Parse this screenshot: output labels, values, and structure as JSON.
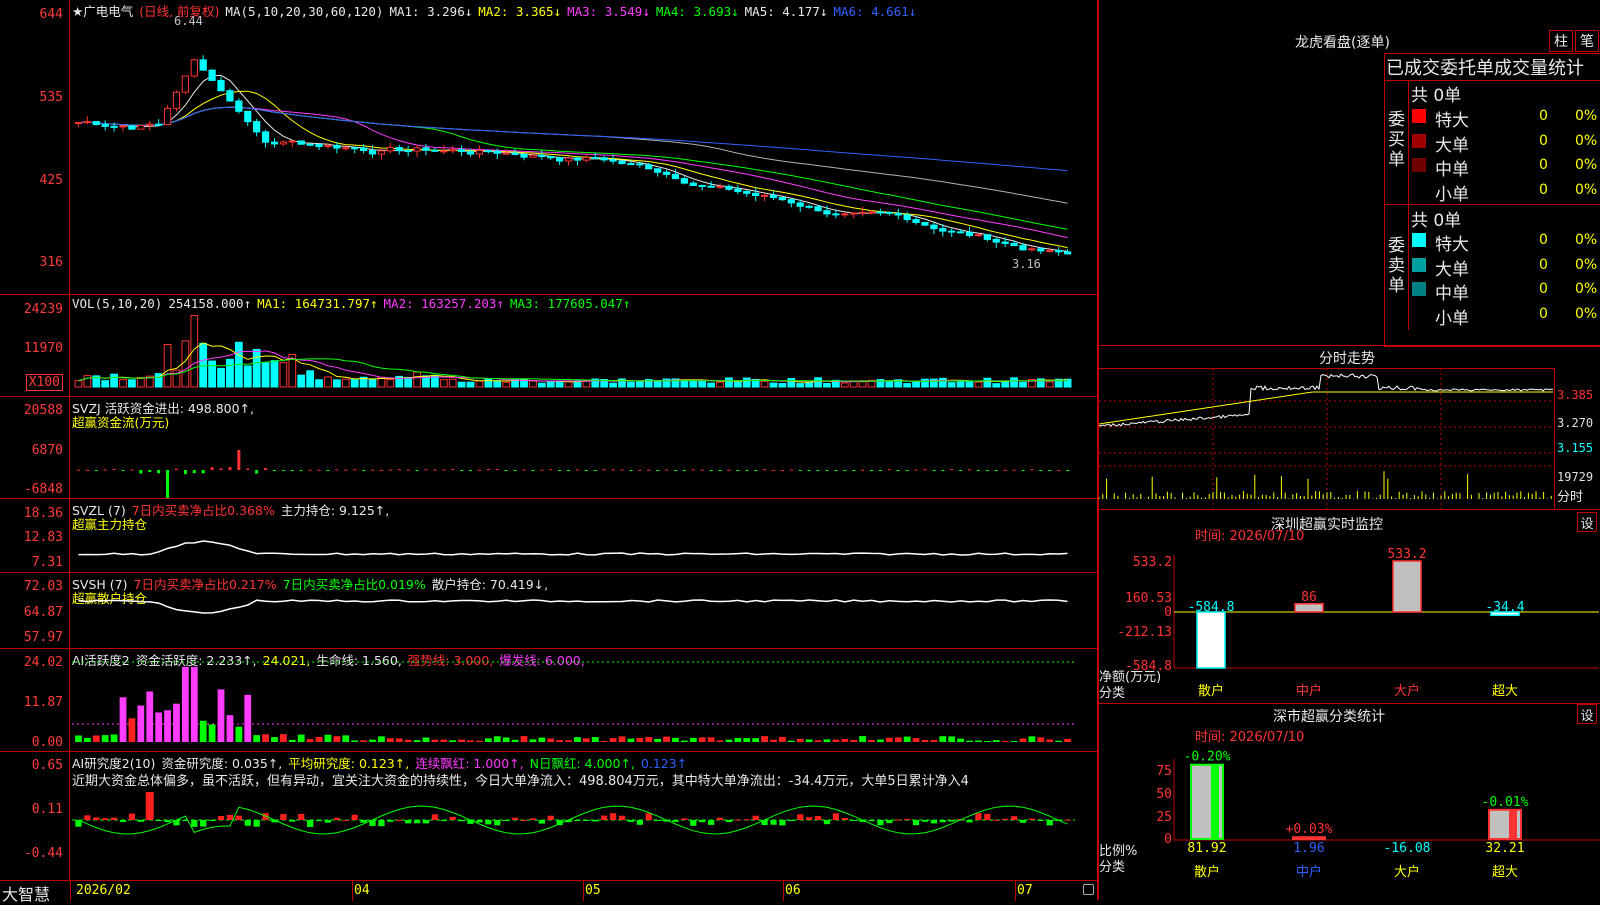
{
  "stock": {
    "name": "★广电电气",
    "period": "(日线, 前复权)",
    "high_label": "6.44",
    "low_label": "3.16"
  },
  "price_panel": {
    "ticks": [
      "644",
      "535",
      "425",
      "316"
    ],
    "ma": [
      {
        "label": "MA(5,10,20,30,60,120)",
        "color": "#e8e8e8"
      },
      {
        "label": "MA1: 3.296↓",
        "color": "#e8e8e8"
      },
      {
        "label": "MA2: 3.365↓",
        "color": "#ffff00"
      },
      {
        "label": "MA3: 3.549↓",
        "color": "#ff3cff"
      },
      {
        "label": "MA4: 3.693↓",
        "color": "#00ff00"
      },
      {
        "label": "MA5: 4.177↓",
        "color": "#e8e8e8"
      },
      {
        "label": "MA6: 4.661↓",
        "color": "#3060ff"
      }
    ]
  },
  "vol_panel": {
    "ticks": [
      "24239",
      "11970",
      "X100"
    ],
    "labels": [
      {
        "label": "VOL(5,10,20)",
        "color": "#e8e8e8"
      },
      {
        "label": "254158.000↑",
        "color": "#e8e8e8"
      },
      {
        "label": "MA1: 164731.797↑",
        "color": "#ffff00"
      },
      {
        "label": "MA2: 163257.203↑",
        "color": "#ff3cff"
      },
      {
        "label": "MA3: 177605.047↑",
        "color": "#00ff00"
      }
    ]
  },
  "svzj_panel": {
    "ticks": [
      "20588",
      "6870",
      "-6848"
    ],
    "line1": "SVZJ  活跃资金进出: 498.800↑,",
    "line2": "超赢资金流(万元)"
  },
  "svzl_panel": {
    "ticks": [
      "18.36",
      "12.83",
      "7.31"
    ],
    "labels": [
      {
        "label": "SVZL (7)",
        "color": "#e8e8e8"
      },
      {
        "label": "7日内买卖净占比0.368%",
        "color": "#ff3333"
      },
      {
        "label": "主力持仓: 9.125↑,",
        "color": "#e8e8e8"
      }
    ],
    "line2": "超赢主力持仓"
  },
  "svsh_panel": {
    "ticks": [
      "72.03",
      "64.87",
      "57.97"
    ],
    "labels": [
      {
        "label": "SVSH (7)",
        "color": "#e8e8e8"
      },
      {
        "label": "7日内买卖净占比0.217%",
        "color": "#ff3333"
      },
      {
        "label": "7日内买卖净占比0.019%",
        "color": "#00ff00"
      },
      {
        "label": "散户持仓: 70.419↓,",
        "color": "#e8e8e8"
      }
    ],
    "line2": "超赢散户持仓"
  },
  "ai1_panel": {
    "ticks": [
      "24.02",
      "11.87",
      "0.00"
    ],
    "labels": [
      {
        "label": "AI活跃度2",
        "color": "#e8e8e8"
      },
      {
        "label": "资金活跃度: 2.233↑,",
        "color": "#e8e8e8"
      },
      {
        "label": "24.021,",
        "color": "#ffff00"
      },
      {
        "label": "生命线: 1.560,",
        "color": "#e8e8e8"
      },
      {
        "label": "强势线: 3.000,",
        "color": "#ff3333"
      },
      {
        "label": "爆发线: 6.000,",
        "color": "#ff3cff"
      }
    ]
  },
  "ai2_panel": {
    "ticks": [
      "0.65",
      "0.11",
      "-0.44"
    ],
    "labels": [
      {
        "label": "AI研究度2(10)",
        "color": "#e8e8e8"
      },
      {
        "label": "资金研究度: 0.035↑,",
        "color": "#e8e8e8"
      },
      {
        "label": "平均研究度: 0.123↑,",
        "color": "#ffff00"
      },
      {
        "label": "连续飘红: 1.000↑,",
        "color": "#ff3cff"
      },
      {
        "label": "N日飘红: 4.000↑,",
        "color": "#00ff00"
      },
      {
        "label": "0.123↑",
        "color": "#3060ff"
      }
    ],
    "comment": "近期大资金总体偏多，虽不活跃，但有异动，宜关注大资金的持续性，今日大单净流入：498.804万元，其中特大单净流出：-34.4万元，大单5日累计净入4"
  },
  "bottom_bar": {
    "brand": "大智慧",
    "dates": [
      "2026/02",
      "04",
      "05",
      "06",
      "07"
    ]
  },
  "dragon": {
    "title": "龙虎看盘(逐单)",
    "btn1": "柱",
    "btn2": "笔",
    "section_title": "已成交委托单成交量统计",
    "buy": {
      "side_label": "委买单",
      "total": "共 0单",
      "rows": [
        {
          "name": "特大",
          "val": "0",
          "pct": "0%",
          "color": "#ff0000"
        },
        {
          "name": "大单",
          "val": "0",
          "pct": "0%",
          "color": "#a00000"
        },
        {
          "name": "中单",
          "val": "0",
          "pct": "0%",
          "color": "#700000"
        },
        {
          "name": "小单",
          "val": "0",
          "pct": "0%",
          "color": ""
        }
      ]
    },
    "sell": {
      "side_label": "委卖单",
      "total": "共 0单",
      "rows": [
        {
          "name": "特大",
          "val": "0",
          "pct": "0%",
          "color": "#00ffff"
        },
        {
          "name": "大单",
          "val": "0",
          "pct": "0%",
          "color": "#00a0a0"
        },
        {
          "name": "中单",
          "val": "0",
          "pct": "0%",
          "color": "#008080"
        },
        {
          "name": "小单",
          "val": "0",
          "pct": "0%",
          "color": ""
        }
      ]
    }
  },
  "intraday": {
    "title": "分时走势",
    "ticks": [
      "3.385",
      "3.270",
      "3.155"
    ],
    "vol_tick": "19729",
    "vol_label": "分时"
  },
  "sz_monitor": {
    "title": "深圳超赢实时监控",
    "btn": "设",
    "time": "时间: 2026/07/10",
    "ticks": [
      "533.2",
      "160.53",
      "0",
      "-212.13",
      "-584.8"
    ],
    "ylabel": "净额(万元)",
    "xlabel": "分类",
    "cats": [
      "散户",
      "中户",
      "大户",
      "超大"
    ],
    "values": [
      -584.8,
      86,
      533.2,
      -34.4
    ],
    "value_labels": [
      "-584.8",
      "86",
      "533.2",
      "-34.4"
    ]
  },
  "sz_class": {
    "title": "深市超赢分类统计",
    "btn": "设",
    "time": "时间: 2026/07/10",
    "ticks": [
      "75",
      "50",
      "25",
      "0"
    ],
    "ylabel": "比例%",
    "xlabel": "分类",
    "cats": [
      "散户",
      "中户",
      "大户",
      "超大"
    ],
    "bars": [
      81.92,
      1.96,
      0,
      32.21
    ],
    "top_labels": [
      "-0.20%",
      "+0.03%",
      "",
      "-0.01%"
    ],
    "bottom_values": [
      "81.92",
      "1.96",
      "-16.08",
      "32.21"
    ]
  }
}
